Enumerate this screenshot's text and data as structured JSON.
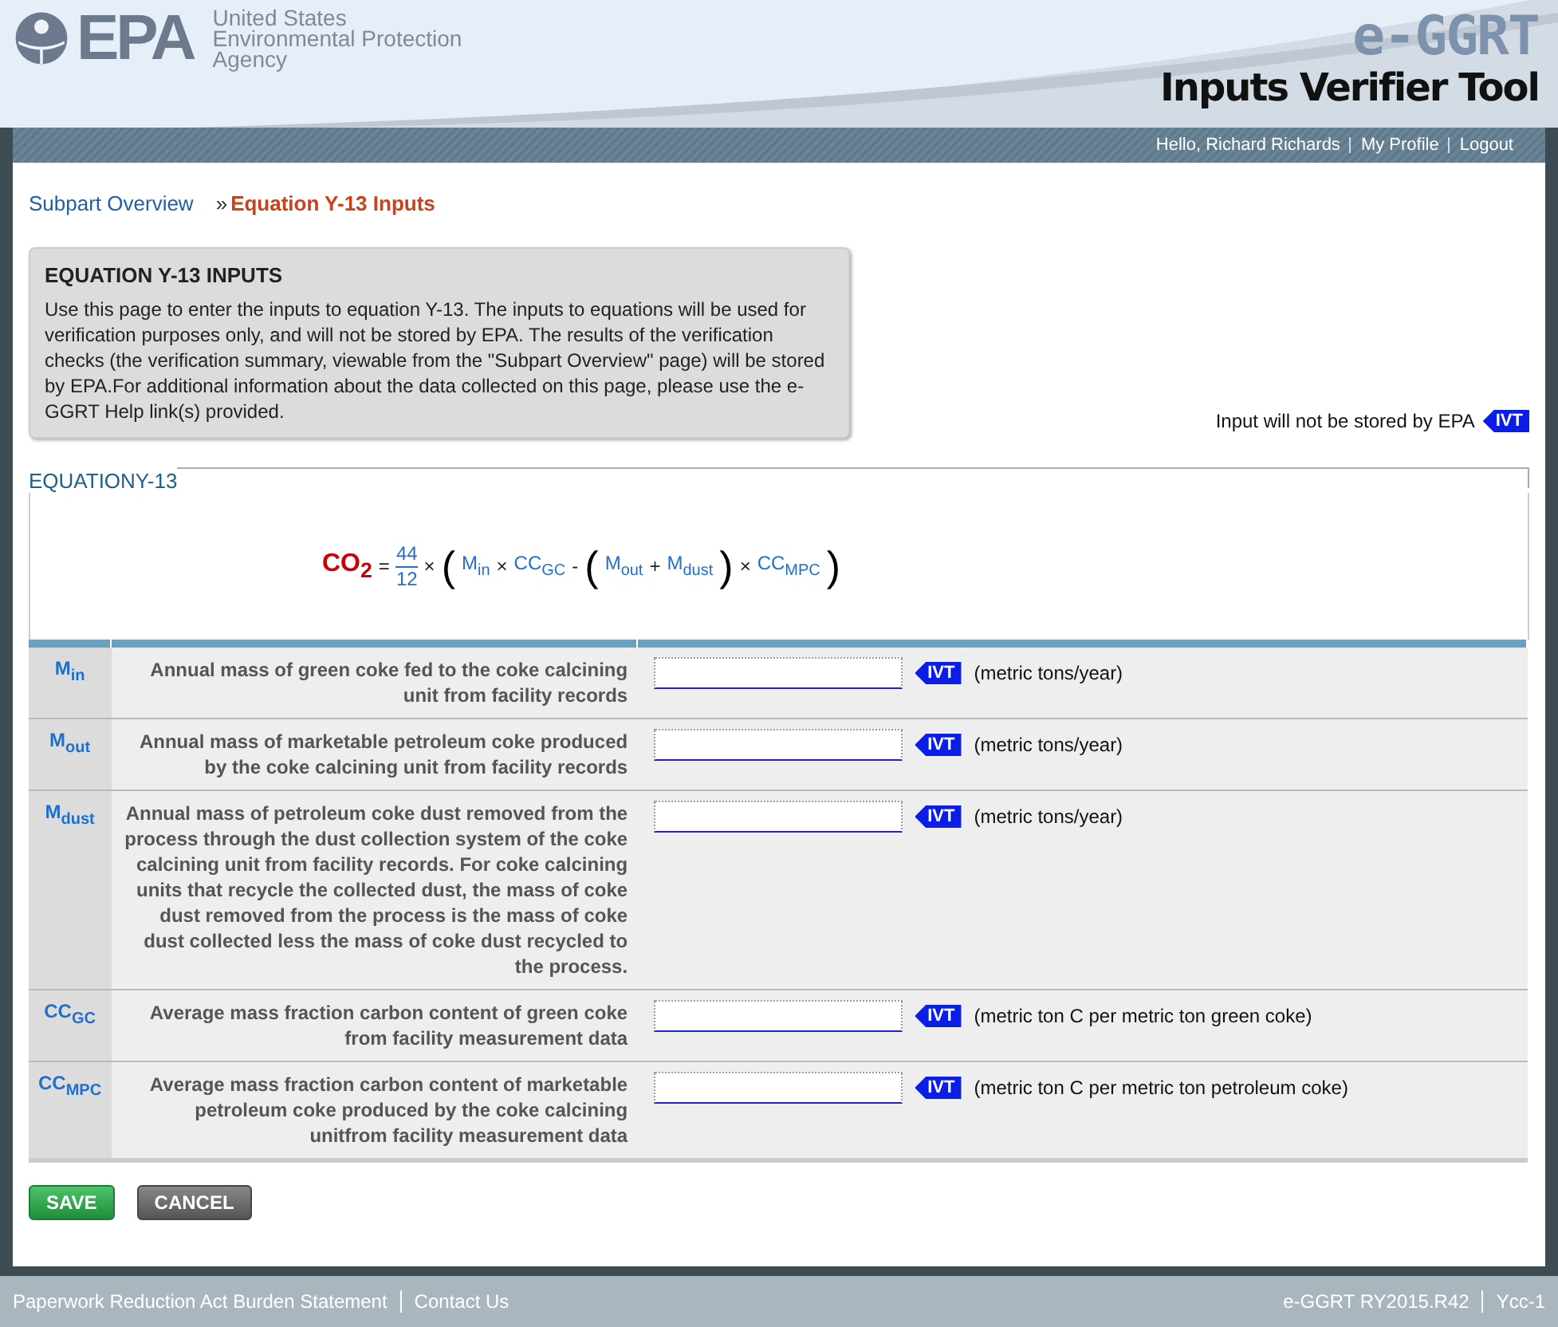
{
  "header": {
    "agency_lines": [
      "United States",
      "Environmental Protection",
      "Agency"
    ],
    "logo_text": "EPA",
    "product": "e-GGRT",
    "tool_title": "Inputs Verifier Tool"
  },
  "user_links": [
    {
      "label": "Hello, Richard Richards"
    },
    {
      "label": "My Profile"
    },
    {
      "label": "Logout"
    }
  ],
  "breadcrumb": [
    {
      "label": "Subpart Overview",
      "selected": false
    },
    {
      "label": "Equation Y-13 Inputs",
      "selected": true
    }
  ],
  "breadcrumb_separator": "»",
  "info_box": {
    "title": "EQUATION Y-13 INPUTS",
    "text": "Use this page to enter the inputs to equation Y-13. The inputs to equations will be used for verification purposes only, and will not be stored by EPA. The results of the verification checks (the verification summary, viewable from the \"Subpart Overview\" page) will be stored by EPA.For additional information about the data collected on this page, please use the e-GGRT Help link(s) provided."
  },
  "storage_note": {
    "text": "Input will not be stored by EPA",
    "badge": "IVT"
  },
  "equation": {
    "legend": "EQUATIONY-13",
    "terms": [
      {
        "kind": "result",
        "text": "CO$_{2}$"
      },
      {
        "kind": "op",
        "text": "="
      },
      {
        "kind": "fraction",
        "numerator": "44",
        "denominator": "12"
      },
      {
        "kind": "op",
        "text": "×"
      },
      {
        "kind": "paren",
        "text": "("
      },
      {
        "kind": "var",
        "text": "M$_{in}$"
      },
      {
        "kind": "op",
        "text": "×"
      },
      {
        "kind": "var",
        "text": "CC$_{GC}$"
      },
      {
        "kind": "op",
        "text": "-"
      },
      {
        "kind": "paren",
        "text": "("
      },
      {
        "kind": "var",
        "text": "M$_{out}$"
      },
      {
        "kind": "op",
        "text": "+"
      },
      {
        "kind": "var",
        "text": "M$_{dust}$"
      },
      {
        "kind": "paren",
        "text": ")"
      },
      {
        "kind": "op",
        "text": "×"
      },
      {
        "kind": "var",
        "text": "CC$_{MPC}$"
      },
      {
        "kind": "paren",
        "text": ")"
      }
    ]
  },
  "inputs": [
    {
      "symbol": "M$_{in}$",
      "description": "Annual mass of green coke fed to the coke calcining unit from facility records",
      "badge": "IVT",
      "unit": "(metric tons/year)"
    },
    {
      "symbol": "M$_{out}$",
      "description": "Annual mass of marketable petroleum coke produced by the coke calcining unit from facility records",
      "badge": "IVT",
      "unit": "(metric tons/year)"
    },
    {
      "symbol": "M$_{dust}$",
      "description": "Annual mass of petroleum coke dust removed from the process through the dust collection system of the coke calcining unit from facility records. For coke calcining units that recycle the collected dust, the mass of coke dust removed from the process is the mass of coke dust collected less the mass of coke dust recycled to the process.",
      "badge": "IVT",
      "unit": "(metric tons/year)"
    },
    {
      "symbol": "CC$_{GC}$",
      "description": "Average mass fraction carbon content of green coke from facility measurement data",
      "badge": "IVT",
      "unit": "(metric ton C per metric ton green coke)"
    },
    {
      "symbol": "CC$_{MPC}$",
      "description": "Average mass fraction carbon content of marketable petroleum coke produced by the coke calcining unitfrom facility measurement data",
      "badge": "IVT",
      "unit": "(metric ton C per metric ton petroleum coke)"
    }
  ],
  "buttons": [
    {
      "label": "SAVE",
      "kind": "primary"
    },
    {
      "label": "CANCEL",
      "kind": "secondary"
    }
  ],
  "footer": {
    "left": [
      "Paperwork Reduction Act Burden Statement",
      "Contact Us"
    ],
    "right": [
      "e-GGRT RY2015.R42",
      "Ycc-1"
    ]
  }
}
